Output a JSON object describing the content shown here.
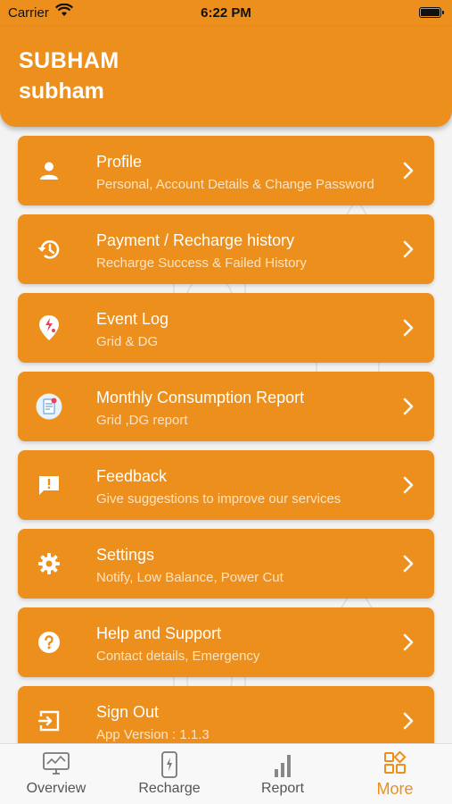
{
  "status_bar": {
    "carrier": "Carrier",
    "time": "6:22 PM",
    "wifi_icon": "wifi-icon",
    "battery_icon": "battery-icon"
  },
  "header": {
    "name_upper": "SUBHAM",
    "name_lower": "subham",
    "background_color": "#ED8F1C"
  },
  "menu": {
    "items": [
      {
        "title": "Profile",
        "subtitle": "Personal, Account Details & Change Password",
        "icon": "person-icon"
      },
      {
        "title": "Payment / Recharge history",
        "subtitle": "Recharge Success & Failed History",
        "icon": "history-icon"
      },
      {
        "title": "Event Log",
        "subtitle": "Grid & DG",
        "icon": "location-bolt-icon"
      },
      {
        "title": "Monthly Consumption Report",
        "subtitle": "Grid ,DG report",
        "icon": "report-icon"
      },
      {
        "title": "Feedback",
        "subtitle": "Give suggestions to improve our services",
        "icon": "feedback-icon"
      },
      {
        "title": "Settings",
        "subtitle": "Notify, Low Balance, Power Cut",
        "icon": "gear-icon"
      },
      {
        "title": "Help and Support",
        "subtitle": "Contact details, Emergency",
        "icon": "help-icon"
      },
      {
        "title": "Sign Out",
        "subtitle": "App Version : 1.1.3",
        "icon": "sign-out-icon"
      }
    ]
  },
  "tabs": [
    {
      "label": "Overview",
      "icon": "monitor-icon",
      "active": false
    },
    {
      "label": "Recharge",
      "icon": "phone-icon",
      "active": false
    },
    {
      "label": "Report",
      "icon": "bar-chart-icon",
      "active": false
    },
    {
      "label": "More",
      "icon": "grid-icon",
      "active": true
    }
  ],
  "colors": {
    "accent": "#ED8F1C",
    "tab_inactive": "#555555"
  }
}
